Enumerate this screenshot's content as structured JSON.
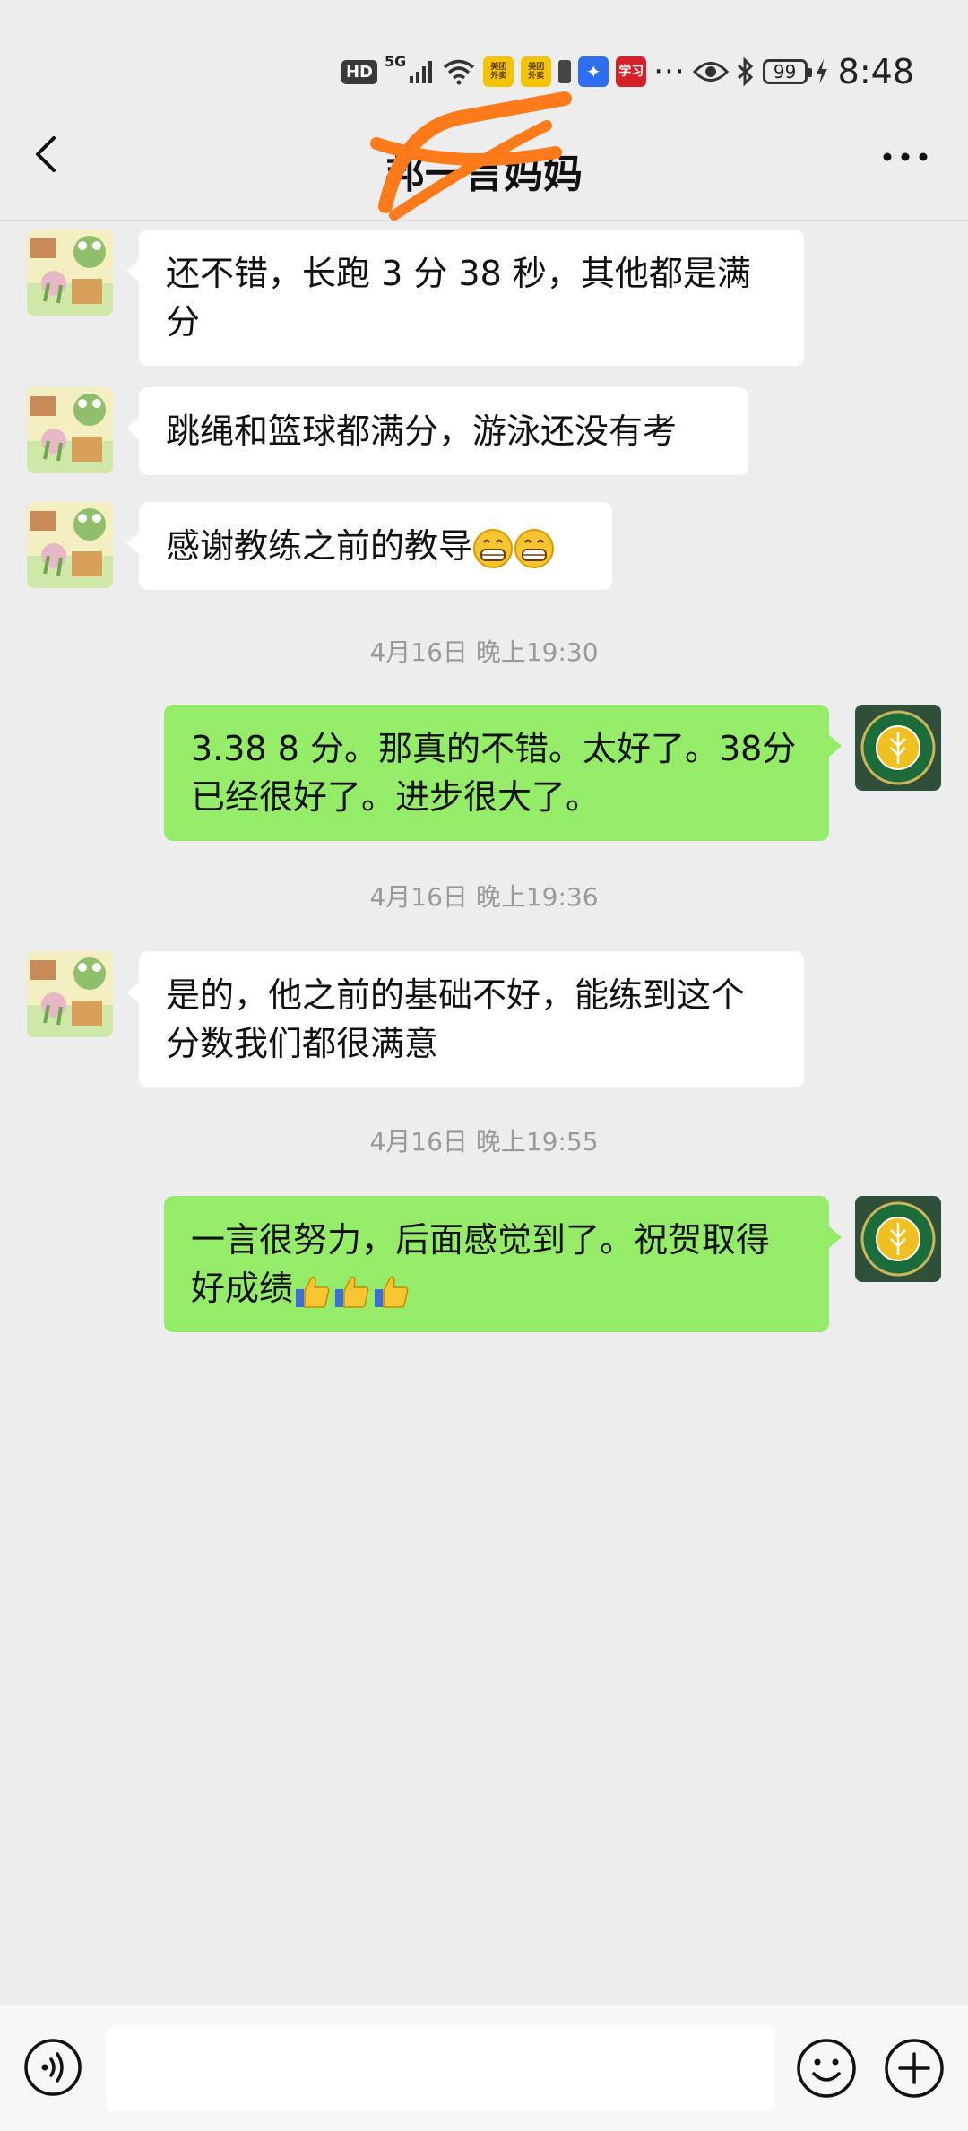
{
  "status_bar": {
    "hd": "HD",
    "network": "5G",
    "app_icon_1": "美团\n外卖",
    "app_icon_2": "美团\n外卖",
    "app_icon_3_symbol": "💡",
    "app_icon_4_text": "学习",
    "more": "···",
    "battery": "99",
    "time": "8:48"
  },
  "header": {
    "title": "邦一言妈妈",
    "back_icon": "chevron-left-icon",
    "more_icon": "more-dots-icon"
  },
  "messages": [
    {
      "sender": "contact",
      "text": "还不错，长跑 3 分 38 秒，其他都是满分"
    },
    {
      "sender": "contact",
      "text": "跳绳和篮球都满分，游泳还没有考"
    },
    {
      "sender": "contact",
      "text": "感谢教练之前的教导"
    },
    {
      "type": "time",
      "text": "4月16日 晚上19:30"
    },
    {
      "sender": "me",
      "text": "3.38 8 分。那真的不错。太好了。38分已经很好了。进步很大了。"
    },
    {
      "type": "time",
      "text": "4月16日 晚上19:36"
    },
    {
      "sender": "contact",
      "text": "是的，他之前的基础不好，能练到这个分数我们都很满意"
    },
    {
      "type": "time",
      "text": "4月16日 晚上19:55"
    },
    {
      "sender": "me",
      "text": "一言很努力，后面感觉到了。祝贺取得好成绩"
    }
  ],
  "input_bar": {
    "placeholder": "",
    "voice_icon": "voice-icon",
    "emoji_icon": "emoji-icon",
    "plus_icon": "plus-icon"
  },
  "colors": {
    "background": "#ededed",
    "bubble_in": "#ffffff",
    "bubble_out": "#95ec69",
    "scribble": "#ff7a1a"
  }
}
